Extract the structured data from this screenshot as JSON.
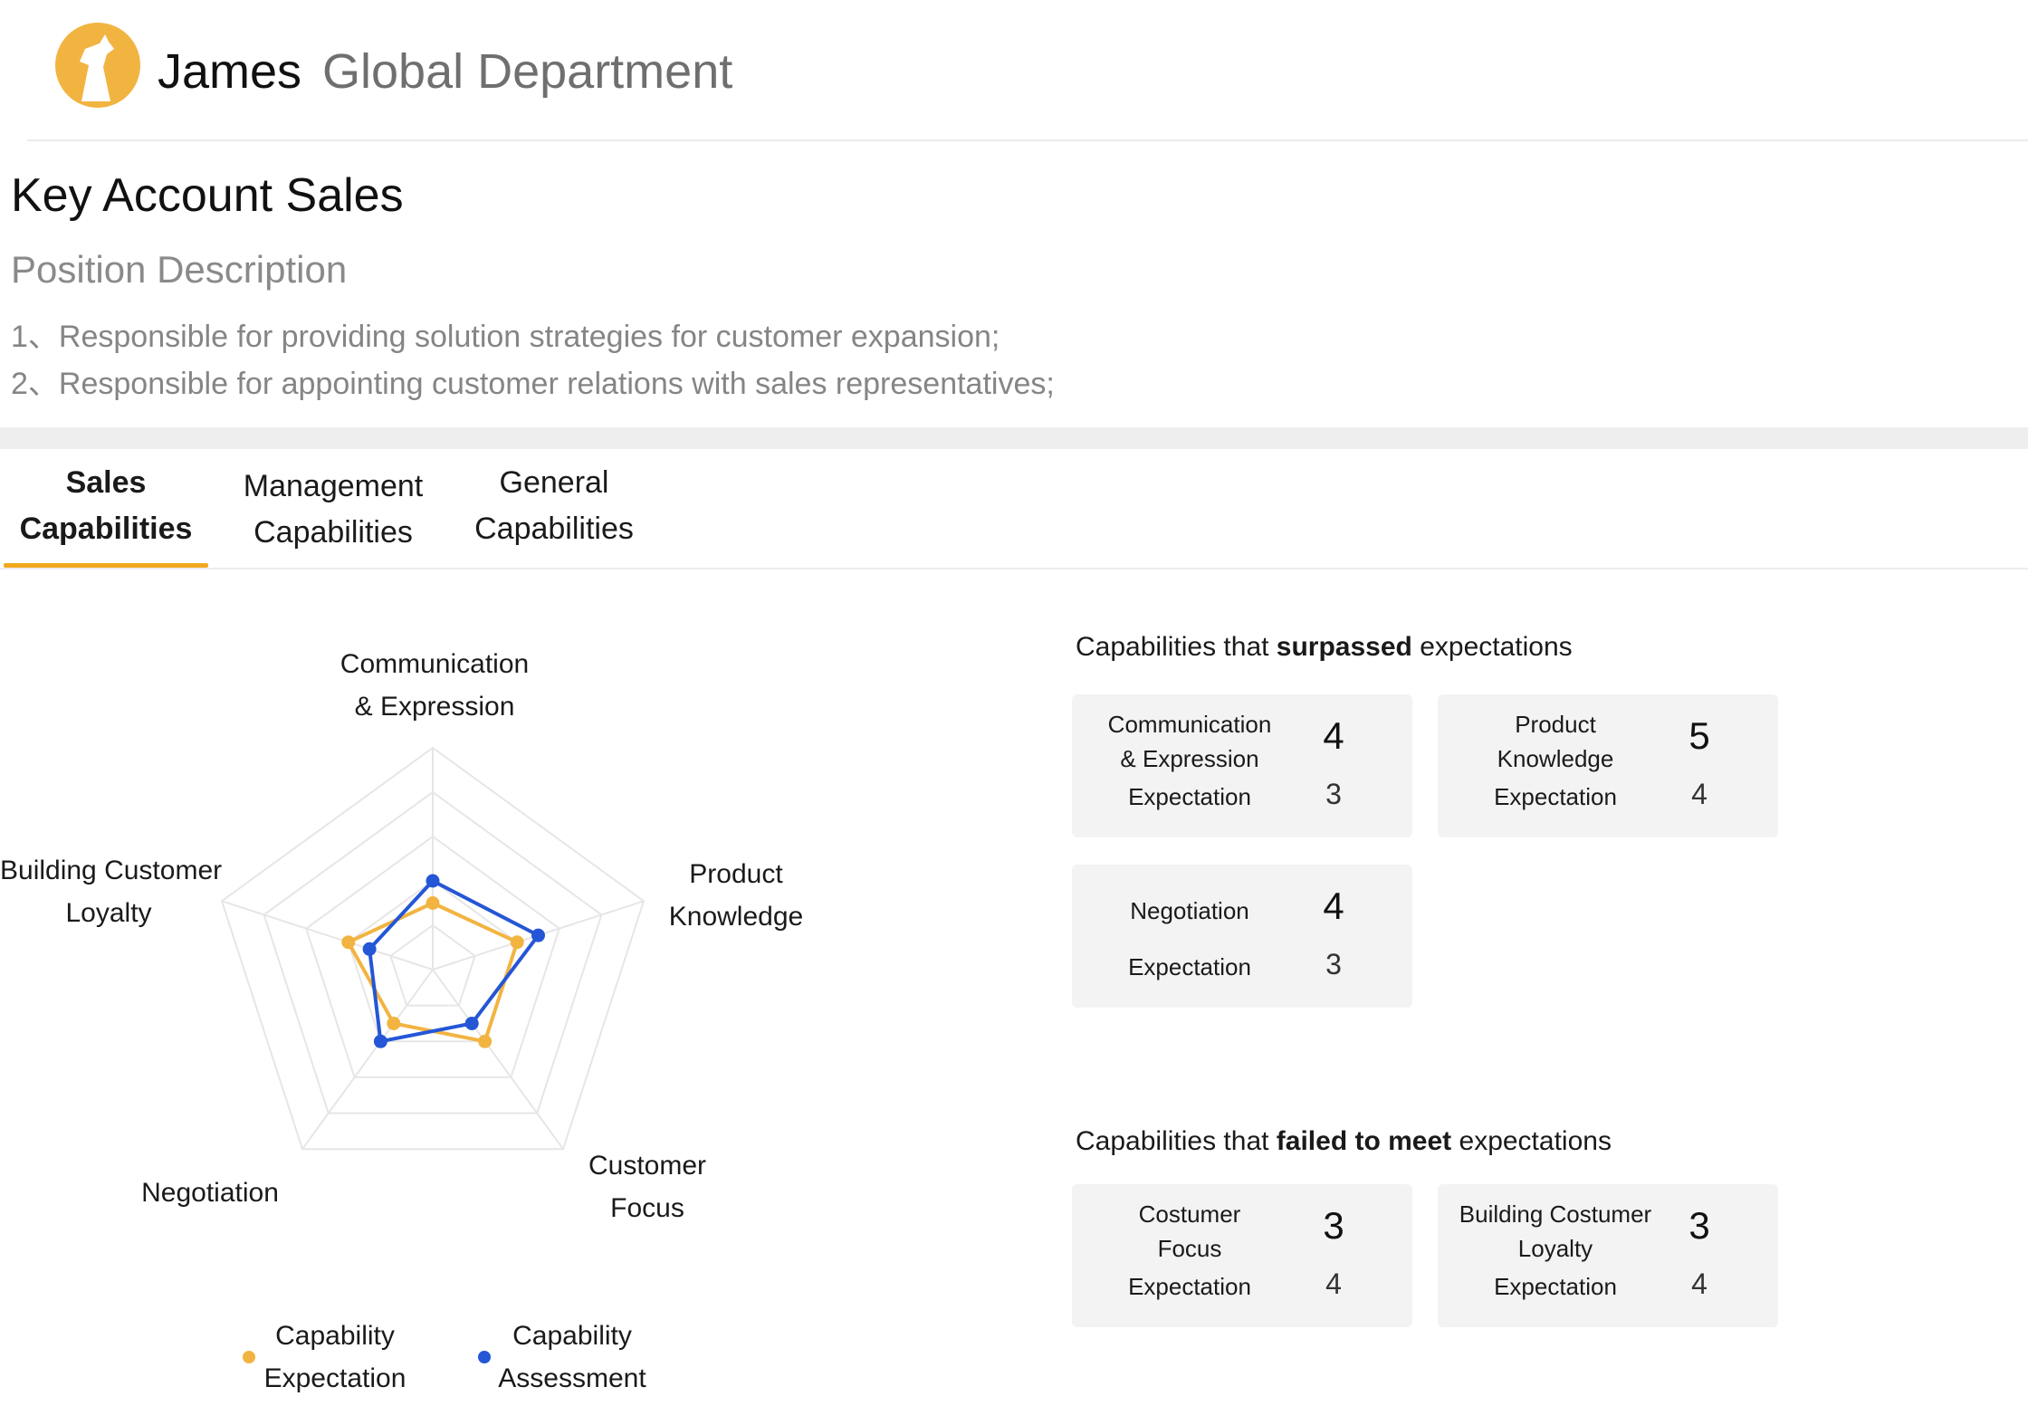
{
  "header": {
    "user_name": "James",
    "department": "Global Department",
    "logo_icon": "giraffe-logo-icon",
    "logo_color": "#f2b441"
  },
  "job": {
    "title": "Key Account Sales",
    "description_heading": "Position Description",
    "description_lines": [
      "1、Responsible for providing solution strategies for customer expansion;",
      "2、Responsible for appointing customer relations with sales representatives;"
    ]
  },
  "tabs": [
    {
      "line1": "Sales",
      "line2": "Capabilities",
      "active": true
    },
    {
      "line1": "Management",
      "line2": "Capabilities",
      "active": false
    },
    {
      "line1": "General",
      "line2": "Capabilities",
      "active": false
    }
  ],
  "chart_data": {
    "type": "radar",
    "axes": [
      {
        "line1": "Communication",
        "line2": "& Expression"
      },
      {
        "line1": "Product",
        "line2": "Knowledge"
      },
      {
        "line1": "Customer",
        "line2": "Focus"
      },
      {
        "line1": "Negotiation",
        "line2": ""
      },
      {
        "line1": "Building Customer",
        "line2": "Loyalty"
      }
    ],
    "max": 10,
    "levels": 5,
    "grid": true,
    "series": [
      {
        "name_line1": "Capability",
        "name_line2": "Expectation",
        "color": "#f2b441",
        "values": [
          3,
          4,
          4,
          3,
          4
        ]
      },
      {
        "name_line1": "Capability",
        "name_line2": "Assessment",
        "color": "#2456d6",
        "values": [
          4,
          5,
          3,
          4,
          3
        ]
      }
    ],
    "legend_position": "bottom"
  },
  "surpassed": {
    "title_prefix": "Capabilities that ",
    "title_bold": "surpassed",
    "title_suffix": " expectations",
    "cards": [
      {
        "name_line1": "Communication",
        "name_line2": "& Expression",
        "score": "4",
        "expectation_label": "Expectation",
        "expectation": "3"
      },
      {
        "name_line1": "Product",
        "name_line2": "Knowledge",
        "score": "5",
        "expectation_label": "Expectation",
        "expectation": "4"
      },
      {
        "name_line1": "Negotiation",
        "name_line2": "",
        "score": "4",
        "expectation_label": "Expectation",
        "expectation": "3"
      }
    ]
  },
  "failed": {
    "title_prefix": "Capabilities that ",
    "title_bold": "failed to meet",
    "title_suffix": " expectations",
    "cards": [
      {
        "name_line1": "Costumer",
        "name_line2": "Focus",
        "score": "3",
        "expectation_label": "Expectation",
        "expectation": "4"
      },
      {
        "name_line1": "Building Costumer",
        "name_line2": "Loyalty",
        "score": "3",
        "expectation_label": "Expectation",
        "expectation": "4"
      }
    ]
  }
}
